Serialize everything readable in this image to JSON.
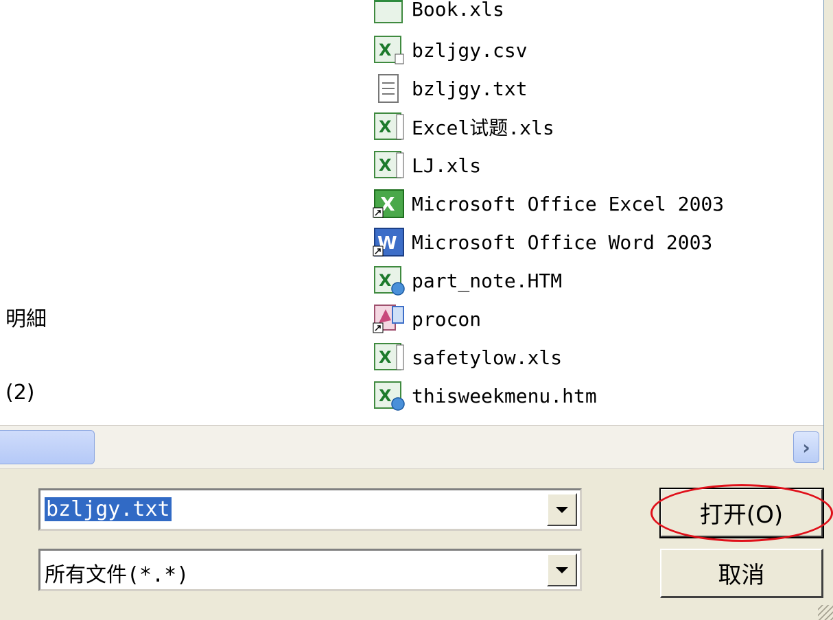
{
  "file_list": {
    "left_column": [
      "明細",
      "(2)"
    ],
    "items": [
      {
        "name": "Book.xls",
        "icon": "excel-file-icon"
      },
      {
        "name": "bzljgy.csv",
        "icon": "csv-file-icon"
      },
      {
        "name": "bzljgy.txt",
        "icon": "text-file-icon"
      },
      {
        "name": "Excel试题.xls",
        "icon": "excel-file-icon"
      },
      {
        "name": "LJ.xls",
        "icon": "excel-file-icon"
      },
      {
        "name": "Microsoft Office Excel 2003",
        "icon": "excel-shortcut-icon"
      },
      {
        "name": "Microsoft Office Word 2003",
        "icon": "word-shortcut-icon"
      },
      {
        "name": "part_note.HTM",
        "icon": "excel-html-file-icon"
      },
      {
        "name": "procon",
        "icon": "publisher-shortcut-icon"
      },
      {
        "name": "safetylow.xls",
        "icon": "excel-file-icon"
      },
      {
        "name": "thisweekmenu.htm",
        "icon": "excel-html-file-icon"
      }
    ]
  },
  "filename_field": {
    "value": "bzljgy.txt"
  },
  "filetype_field": {
    "value": "所有文件(*.*)"
  },
  "buttons": {
    "open_label": "打开(O)",
    "cancel_label": "取消"
  },
  "colors": {
    "selection": "#316ac5",
    "highlight_circle": "#e0101a",
    "dialog_bg": "#ece9d8"
  }
}
